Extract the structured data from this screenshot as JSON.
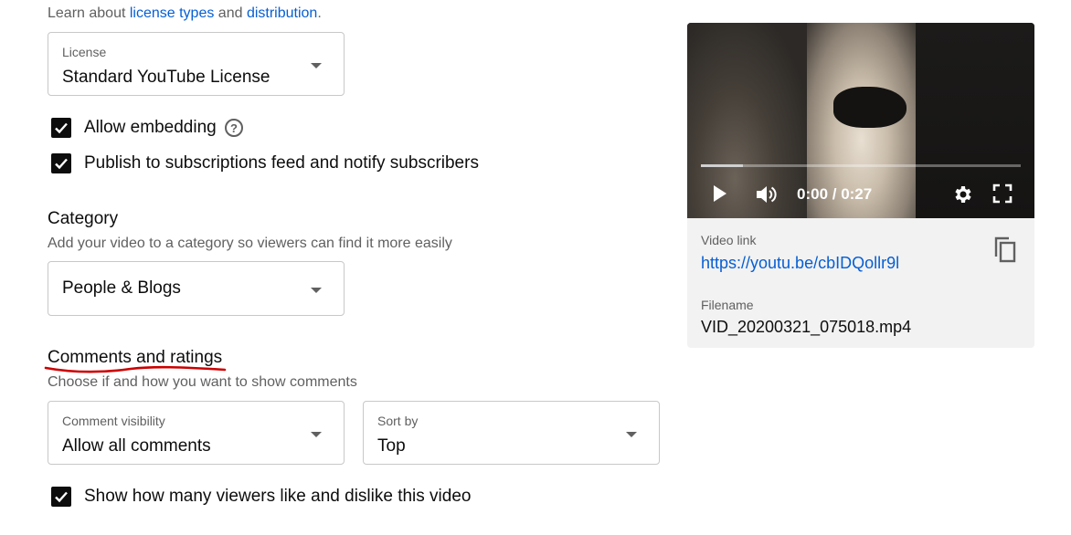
{
  "license_intro": {
    "prefix": "Learn about ",
    "license_types_link": "license types",
    "middle": " and ",
    "distribution_link": "distribution",
    "suffix": "."
  },
  "license": {
    "label": "License",
    "value": "Standard YouTube License"
  },
  "checkboxes": {
    "allow_embedding": {
      "label": "Allow embedding",
      "checked": true
    },
    "publish_feed": {
      "label": "Publish to subscriptions feed and notify subscribers",
      "checked": true
    },
    "show_likes": {
      "label": "Show how many viewers like and dislike this video",
      "checked": true
    }
  },
  "category": {
    "title": "Category",
    "description": "Add your video to a category so viewers can find it more easily",
    "value": "People & Blogs"
  },
  "comments": {
    "title": "Comments and ratings",
    "description": "Choose if and how you want to show comments",
    "visibility_label": "Comment visibility",
    "visibility_value": "Allow all comments",
    "sort_label": "Sort by",
    "sort_value": "Top"
  },
  "video": {
    "time": "0:00 / 0:27",
    "progress": 0.13,
    "link_label": "Video link",
    "link": "https://youtu.be/cbIDQollr9l",
    "filename_label": "Filename",
    "filename": "VID_20200321_075018.mp4"
  },
  "colors": {
    "link": "#065fd4",
    "annotation": "#cc0000",
    "muted": "#606060"
  },
  "icons": [
    "help-icon",
    "chevron-down-icon",
    "checkmark-icon",
    "play-icon",
    "volume-icon",
    "settings-gear-icon",
    "fullscreen-icon",
    "copy-icon"
  ]
}
